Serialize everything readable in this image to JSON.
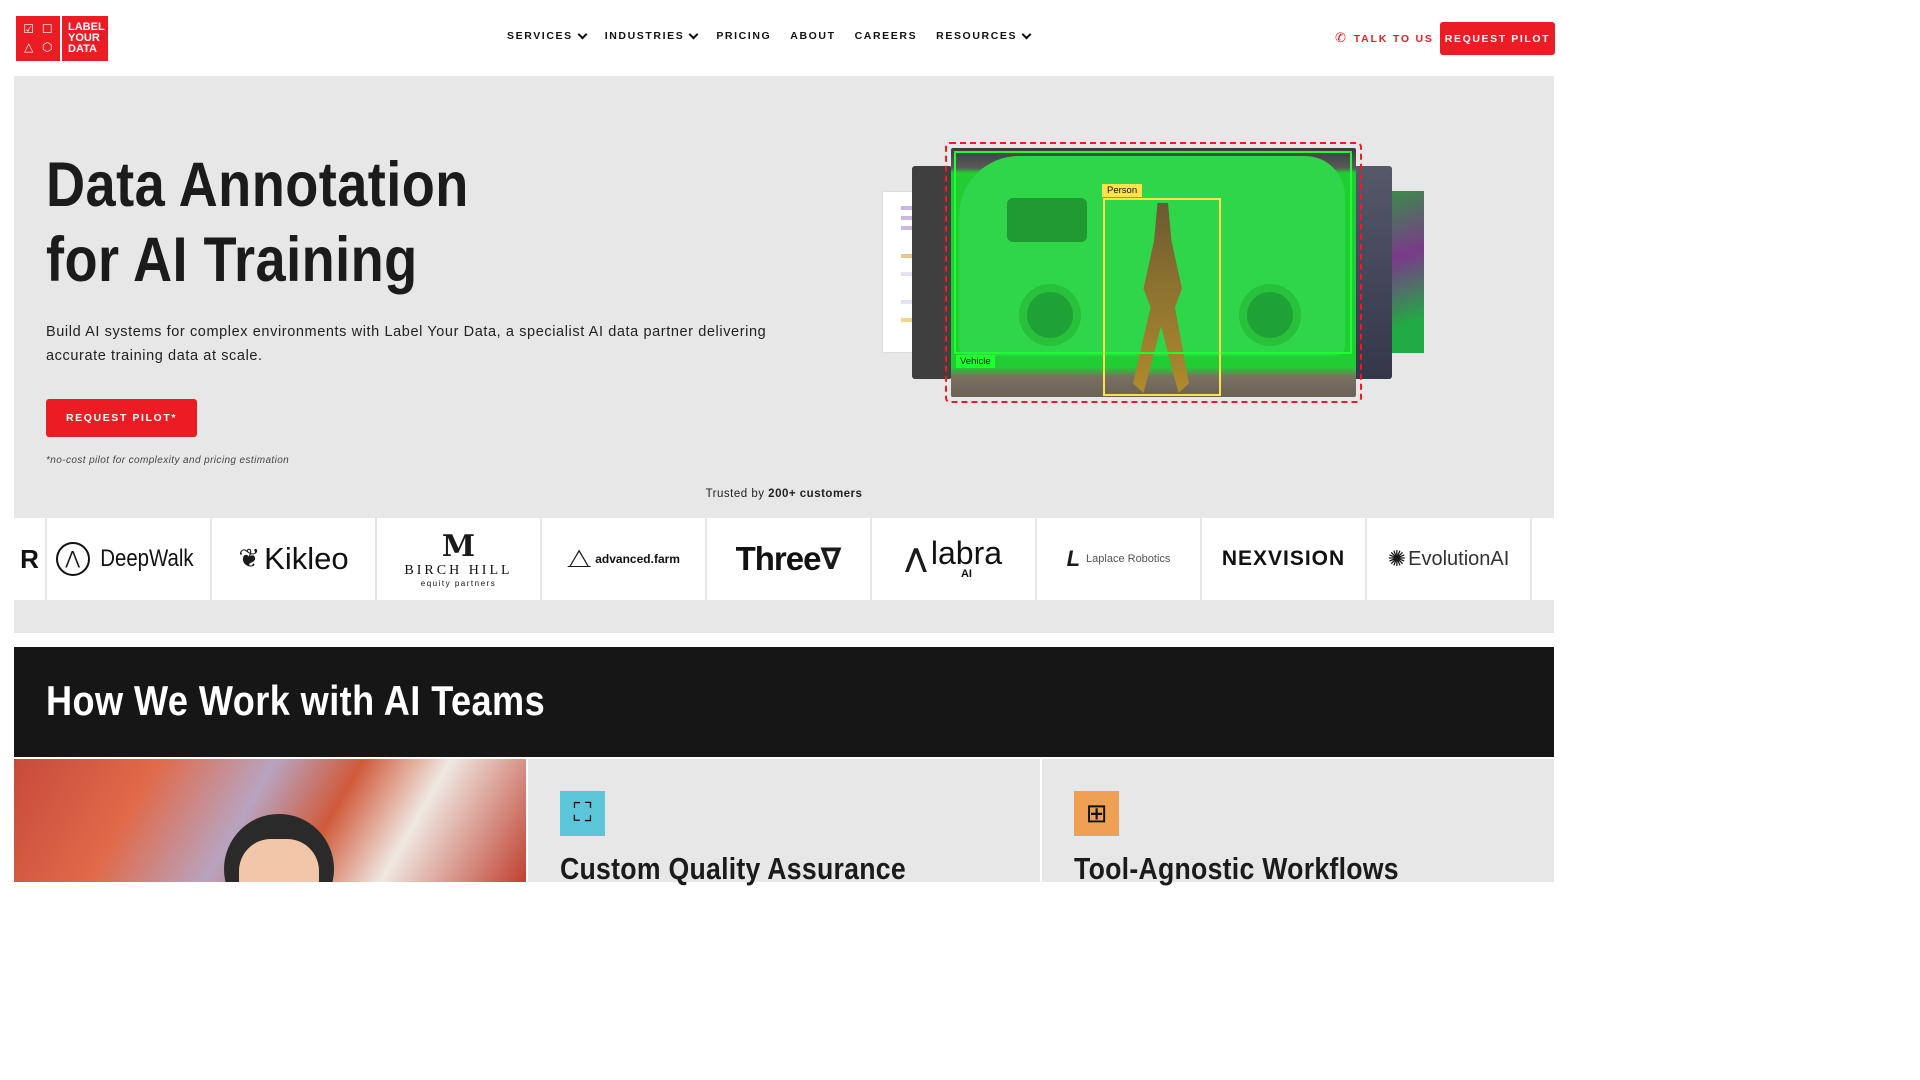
{
  "header": {
    "logo_text": [
      "LABEL",
      "YOUR",
      "DATA"
    ],
    "logo_icons": [
      "☑",
      "☐",
      "△",
      "⬡"
    ],
    "nav": [
      {
        "label": "SERVICES",
        "has_dropdown": true
      },
      {
        "label": "INDUSTRIES",
        "has_dropdown": true
      },
      {
        "label": "PRICING",
        "has_dropdown": false
      },
      {
        "label": "ABOUT",
        "has_dropdown": false
      },
      {
        "label": "CAREERS",
        "has_dropdown": false
      },
      {
        "label": "RESOURCES",
        "has_dropdown": true
      }
    ],
    "talk_label": "TALK TO US",
    "request_label": "REQUEST PILOT"
  },
  "hero": {
    "title_line1": "Data Annotation",
    "title_line2": "for AI Training",
    "subtitle": "Build AI systems for complex environments with Label Your Data, a specialist AI data partner delivering accurate training data at scale.",
    "cta_label": "REQUEST PILOT*",
    "note": "*no-cost pilot for complexity and pricing estimation",
    "trusted_prefix": "Trusted by ",
    "trusted_bold": "200+ customers",
    "annotation_tags": {
      "vehicle": "Vehicle",
      "person": "Person"
    }
  },
  "customers": [
    "R",
    "DeepWalk",
    "Kikleo",
    "BIRCH HILL",
    "equity partners",
    "advanced.farm",
    "Three",
    "labra",
    "AI",
    "Laplace Robotics",
    "NEXVISION",
    "EvolutionAI"
  ],
  "how_section": {
    "title": "How We Work with AI Teams",
    "cards": [
      {
        "title": "Custom Quality Assurance",
        "icon": "focus-sparkle-icon",
        "color": "#5bc6d8"
      },
      {
        "title": "Tool-Agnostic Workflows",
        "icon": "grid-squares-icon",
        "color": "#f0a052"
      }
    ]
  },
  "colors": {
    "brand_red": "#ec1c24",
    "hero_bg": "#e7e7e7",
    "dark_bg": "#161616"
  }
}
